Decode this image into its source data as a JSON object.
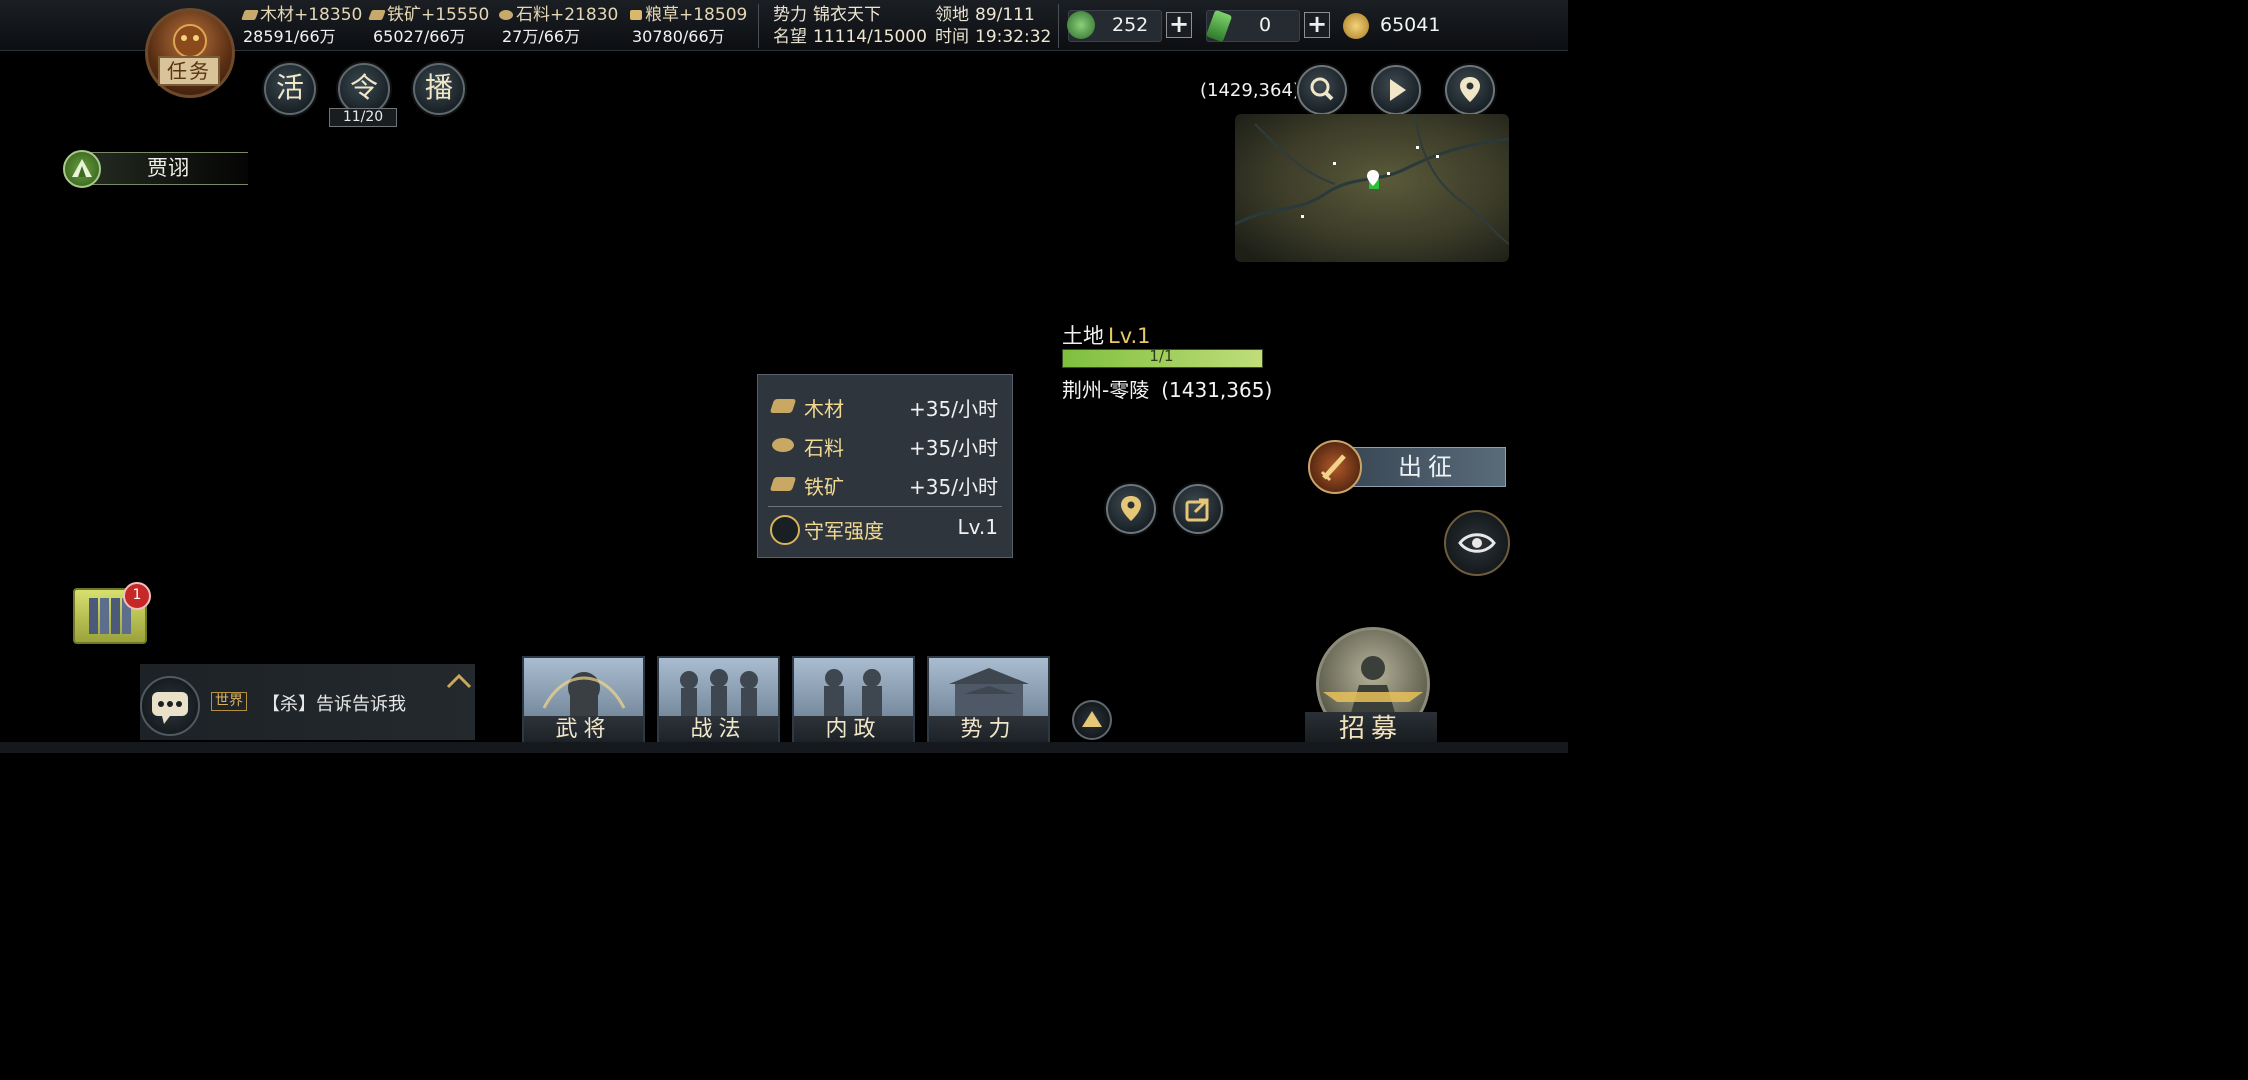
{
  "resources": [
    {
      "icon": "wood-icon",
      "name": "木材",
      "rate": "+18350",
      "amount": "28591/66万"
    },
    {
      "icon": "iron-icon",
      "name": "铁矿",
      "rate": "+15550",
      "amount": "65027/66万"
    },
    {
      "icon": "stone-icon",
      "name": "石料",
      "rate": "+21830",
      "amount": "27万/66万"
    },
    {
      "icon": "grain-icon",
      "name": "粮草",
      "rate": "+18509",
      "amount": "30780/66万"
    }
  ],
  "status": {
    "faction_label": "势力",
    "faction_value": "锦衣天下",
    "prestige_label": "名望",
    "prestige_value": "11114/15000",
    "territory_label": "领地",
    "territory_value": "89/111",
    "time_label": "时间",
    "time_value": "19:32:32"
  },
  "currency": {
    "jade": "252",
    "bamboo": "0",
    "copper": "65041"
  },
  "mission": {
    "label": "任务"
  },
  "quick_buttons": [
    {
      "label": "活"
    },
    {
      "label": "令",
      "counter": "11/20"
    },
    {
      "label": "播"
    }
  ],
  "general": {
    "name": "贾诩"
  },
  "map": {
    "current_coords": "(1429,364)"
  },
  "tile": {
    "type": "土地",
    "level": "Lv.1",
    "durability": "1/1",
    "durability_fraction": 1.0,
    "location": "荆州-零陵",
    "coords": "(1431,365)"
  },
  "production": [
    {
      "icon": "wood-icon",
      "name": "木材",
      "rate": "+35/小时"
    },
    {
      "icon": "stone-icon",
      "name": "石料",
      "rate": "+35/小时"
    },
    {
      "icon": "iron-icon",
      "name": "铁矿",
      "rate": "+35/小时"
    }
  ],
  "garrison": {
    "label": "守军强度",
    "value": "Lv.1"
  },
  "march": {
    "label": "出征"
  },
  "book_badge": "1",
  "chat": {
    "channel": "世界",
    "message": "【杀】告诉告诉我"
  },
  "tabs": [
    {
      "label": "武将"
    },
    {
      "label": "战法"
    },
    {
      "label": "内政"
    },
    {
      "label": "势力"
    }
  ],
  "recruit": {
    "label": "招募"
  },
  "colors": {
    "accent_gold": "#e8c86a",
    "panel_bg": "#2e353c",
    "bar_green": "#7ebf3e"
  }
}
